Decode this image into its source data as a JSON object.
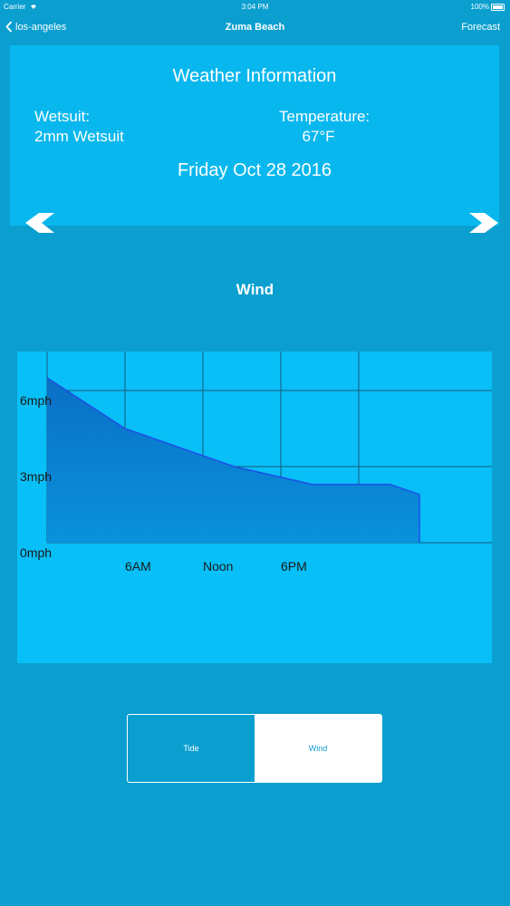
{
  "status_bar": {
    "carrier": "Carrier",
    "time": "3:04 PM",
    "battery": "100%"
  },
  "nav": {
    "back_label": "los-angeles",
    "title": "Zuma Beach",
    "right_label": "Forecast"
  },
  "weather": {
    "title": "Weather Information",
    "wetsuit_label": "Wetsuit:",
    "wetsuit_value": "2mm Wetsuit",
    "temperature_label": "Temperature:",
    "temperature_value": "67°F",
    "date": "Friday Oct 28 2016"
  },
  "icons": {
    "back": "chevron-left-icon",
    "previous": "chevron-left-icon",
    "next": "chevron-right-icon",
    "wifi": "wifi-icon",
    "battery": "battery-icon"
  },
  "section_title": "Wind",
  "chart_data": {
    "type": "area",
    "title": "",
    "x_tick_labels": [
      "6AM",
      "Noon",
      "6PM"
    ],
    "y_tick_labels": [
      "0mph",
      "3mph",
      "6mph"
    ],
    "ylim": [
      0,
      7.5
    ],
    "x_hours": [
      0,
      5,
      10,
      15,
      20
    ],
    "series": [
      {
        "x": [
          0,
          5,
          12,
          17,
          22,
          23.9
        ],
        "y": [
          6.5,
          4.5,
          3.0,
          2.3,
          2.3,
          1.9
        ]
      }
    ],
    "grid": true
  },
  "segmented_control": {
    "options": [
      "Tide",
      "Wind"
    ],
    "selected": "Wind"
  },
  "colors": {
    "background": "#0b9fcf",
    "card": "#08b7ee",
    "chart_bg": "#08bff7",
    "area_fill_top": "#0a6fc6",
    "area_fill_bottom": "#0a92dc",
    "line": "#1e4fe6",
    "grid": "#1a5a78"
  }
}
